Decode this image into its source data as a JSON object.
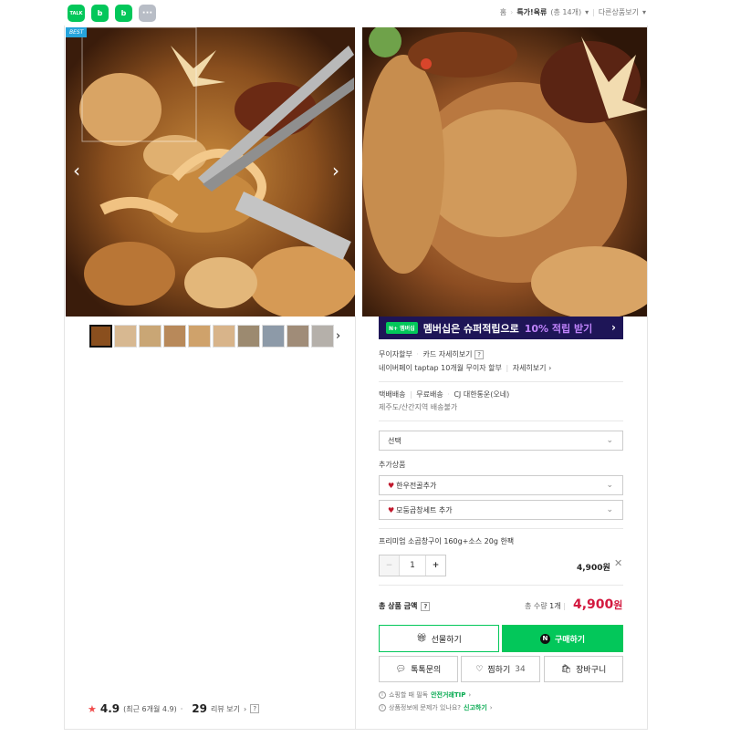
{
  "topbar": {
    "share_icons": [
      {
        "icon": "talktalk-icon",
        "label": "TALK"
      },
      {
        "icon": "band-icon",
        "label": "b"
      },
      {
        "icon": "blog-icon",
        "label": "b"
      },
      {
        "icon": "more-icon",
        "label": "···"
      }
    ],
    "crumbs": {
      "home": "홈",
      "current": "특가!육류",
      "count": "(총 14개)",
      "other": "다른상품보기"
    }
  },
  "gallery": {
    "badge": "BEST",
    "thumb_count": 10
  },
  "rating": {
    "score": "4.9",
    "period": "(최근 6개월 4.9)",
    "review_count": "29",
    "review_link": "리뷰 보기",
    "help": "?"
  },
  "banner": {
    "pill": "N+ 멤버십",
    "text": "멤버십은 슈퍼적립으로",
    "highlight": "10% 적립 받기"
  },
  "payment": {
    "line1_a": "무이자할부",
    "line1_b": "카드 자세히보기",
    "line2_a": "네이버페이 taptap 10개월 무이자 할부",
    "line2_b": "자세히보기"
  },
  "shipping": {
    "line1_a": "택배배송",
    "line1_b": "무료배송",
    "line1_c": "CJ 대한통운(오네)",
    "line2": "제주도/산간지역 배송불가"
  },
  "options": {
    "main_select": "선택",
    "addon_title": "추가상품",
    "addon1": "한우전골추가",
    "addon2": "모둠곱창세트 추가"
  },
  "selected": {
    "name": "프리미엄 소곱창구이 160g+소스 20g 한팩",
    "qty": "1",
    "price": "4,900원"
  },
  "total": {
    "label": "총 상품 금액",
    "count_label": "총 수량",
    "count": "1개",
    "price": "4,900",
    "won": "원"
  },
  "buttons": {
    "gift": "선물하기",
    "buy": "구매하기",
    "talk": "톡톡문의",
    "zzim": "찜하기",
    "zzim_count": "34",
    "cart": "장바구니"
  },
  "notices": {
    "n1_a": "쇼핑할 때 필독",
    "n1_b": "안전거래TIP",
    "n2_a": "상품정보에 문제가 있나요?",
    "n2_b": "신고하기"
  },
  "colors": {
    "brand_green": "#03c75a",
    "price_red": "#d3193f",
    "banner_navy": "#1e1557"
  }
}
